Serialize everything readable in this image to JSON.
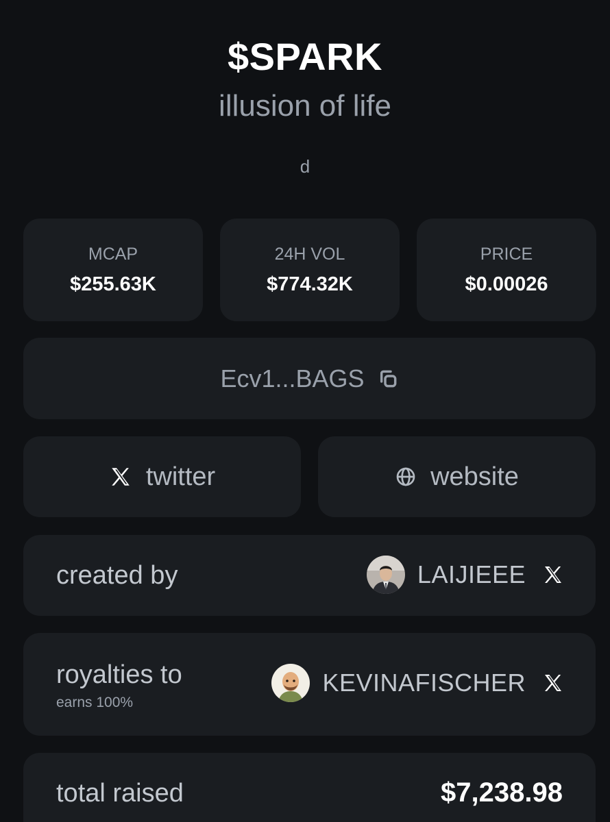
{
  "token": {
    "ticker": "$SPARK",
    "name": "illusion of life",
    "description": "d"
  },
  "stats": [
    {
      "label": "MCAP",
      "value": "$255.63K"
    },
    {
      "label": "24H VOL",
      "value": "$774.32K"
    },
    {
      "label": "PRICE",
      "value": "$0.00026"
    }
  ],
  "contract": {
    "address": "Ecv1...BAGS",
    "icon": "copy-icon"
  },
  "links": {
    "twitter": {
      "label": "twitter",
      "icon": "x-logo-icon"
    },
    "website": {
      "label": "website",
      "icon": "globe-icon"
    }
  },
  "created_by": {
    "label": "created by",
    "username": "LAIJIEEE",
    "icon": "x-logo-icon"
  },
  "royalties": {
    "label": "royalties to",
    "sublabel": "earns 100%",
    "username": "KEVINAFISCHER",
    "icon": "x-logo-icon"
  },
  "total_raised": {
    "label": "total raised",
    "value": "$7,238.98"
  },
  "colors": {
    "background": "#0f1114",
    "card": "#1a1d21",
    "muted_text": "#9aa1ab",
    "primary_text": "#ffffff"
  }
}
